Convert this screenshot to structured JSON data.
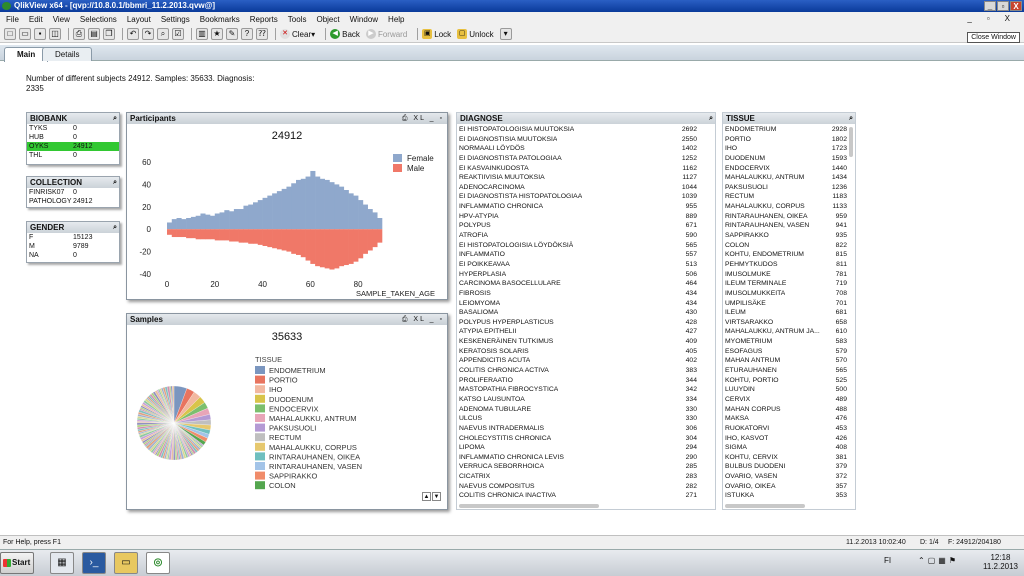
{
  "window": {
    "title": "QlikView x64 - [qvp://10.8.0.1/bbmri_11.2.2013.qvw@]",
    "close_window_label": "Close Window",
    "controls": [
      "_",
      "▫",
      "X"
    ],
    "mdi_controls": [
      "_",
      "▫",
      "X"
    ]
  },
  "menu": [
    "File",
    "Edit",
    "View",
    "Selections",
    "Layout",
    "Settings",
    "Bookmarks",
    "Reports",
    "Tools",
    "Object",
    "Window",
    "Help"
  ],
  "toolbar": {
    "clear": "Clear",
    "back": "Back",
    "forward": "Forward",
    "lock": "Lock",
    "unlock": "Unlock"
  },
  "tabs": [
    {
      "label": "Main",
      "active": true
    },
    {
      "label": "Details",
      "active": false
    }
  ],
  "summary": "Number of different subjects 24912. Samples: 35633. Diagnosis: 2335",
  "biobank": {
    "title": "BIOBANK",
    "rows": [
      {
        "name": "TYKS",
        "value": "0",
        "selected": false
      },
      {
        "name": "HUB",
        "value": "0",
        "selected": false
      },
      {
        "name": "OYKS",
        "value": "24912",
        "selected": true
      },
      {
        "name": "THL",
        "value": "0",
        "selected": false
      }
    ]
  },
  "collection": {
    "title": "COLLECTION",
    "rows": [
      {
        "name": "FINRISK07",
        "value": "0"
      },
      {
        "name": "PATHOLOGY",
        "value": "24912"
      }
    ]
  },
  "gender": {
    "title": "GENDER",
    "rows": [
      {
        "name": "F",
        "value": "15123"
      },
      {
        "name": "M",
        "value": "9789"
      },
      {
        "name": "NA",
        "value": "0"
      }
    ]
  },
  "participants": {
    "title": "Participants",
    "controls": "⎙ XL _ ▫",
    "total": "24912"
  },
  "samples": {
    "title": "Samples",
    "controls": "⎙ XL _ ▫",
    "total": "35633"
  },
  "diagnose": {
    "title": "DIAGNOSE",
    "rows": [
      [
        "EI HISTOPATOLOGISIA MUUTOKSIA",
        "2692"
      ],
      [
        "EI DIAGNOSTISIA MUUTOKSIA",
        "2550"
      ],
      [
        "NORMAALI LÖYDÖS",
        "1402"
      ],
      [
        "EI DIAGNOSTISTA PATOLOGIAA",
        "1252"
      ],
      [
        "EI KASVAINKUDOSTA",
        "1162"
      ],
      [
        "REAKTIIVISIA MUUTOKSIA",
        "1127"
      ],
      [
        "ADENOCARCINOMA",
        "1044"
      ],
      [
        "EI DIAGNOSTISTA HISTOPATOLOGIAA",
        "1039"
      ],
      [
        "INFLAMMATIO CHRONICA",
        "955"
      ],
      [
        "HPV-ATYPIA",
        "889"
      ],
      [
        "POLYPUS",
        "671"
      ],
      [
        "ATROFIA",
        "590"
      ],
      [
        "EI HISTOPATOLOGISIA LÖYDÖKSIÄ",
        "565"
      ],
      [
        "INFLAMMATIO",
        "557"
      ],
      [
        "EI POIKKEAVAA",
        "513"
      ],
      [
        "HYPERPLASIA",
        "506"
      ],
      [
        "CARCINOMA BASOCELLULARE",
        "464"
      ],
      [
        "FIBROSIS",
        "434"
      ],
      [
        "LEIOMYOMA",
        "434"
      ],
      [
        "BASALIOMA",
        "430"
      ],
      [
        "POLYPUS HYPERPLASTICUS",
        "428"
      ],
      [
        "ATYPIA EPITHELII",
        "427"
      ],
      [
        "KESKENERÄINEN TUTKIMUS",
        "409"
      ],
      [
        "KERATOSIS SOLARIS",
        "405"
      ],
      [
        "APPENDICITIS ACUTA",
        "402"
      ],
      [
        "COLITIS CHRONICA ACTIVA",
        "383"
      ],
      [
        "PROLIFERAATIO",
        "344"
      ],
      [
        "MASTOPATHIA FIBROCYSTICA",
        "342"
      ],
      [
        "KATSO LAUSUNTOA",
        "334"
      ],
      [
        "ADENOMA TUBULARE",
        "330"
      ],
      [
        "ULCUS",
        "330"
      ],
      [
        "NAEVUS INTRADERMALIS",
        "306"
      ],
      [
        "CHOLECYSTITIS CHRONICA",
        "304"
      ],
      [
        "LIPOMA",
        "294"
      ],
      [
        "INFLAMMATIO CHRONICA LEVIS",
        "290"
      ],
      [
        "VERRUCA SEBORRHOICA",
        "285"
      ],
      [
        "CICATRIX",
        "283"
      ],
      [
        "NAEVUS COMPOSITUS",
        "282"
      ],
      [
        "COLITIS CHRONICA INACTIVA",
        "271"
      ]
    ]
  },
  "tissue": {
    "title": "TISSUE",
    "rows": [
      [
        "ENDOMETRIUM",
        "2928"
      ],
      [
        "PORTIO",
        "1802"
      ],
      [
        "IHO",
        "1723"
      ],
      [
        "DUODENUM",
        "1593"
      ],
      [
        "ENDOCERVIX",
        "1440"
      ],
      [
        "MAHALAUKKU, ANTRUM",
        "1434"
      ],
      [
        "PAKSUSUOLI",
        "1236"
      ],
      [
        "RECTUM",
        "1183"
      ],
      [
        "MAHALAUKKU, CORPUS",
        "1133"
      ],
      [
        "RINTARAUHANEN, OIKEA",
        "959"
      ],
      [
        "RINTARAUHANEN, VASEN",
        "941"
      ],
      [
        "SAPPIRAKKO",
        "935"
      ],
      [
        "COLON",
        "822"
      ],
      [
        "KOHTU, ENDOMETRIUM",
        "815"
      ],
      [
        "PEHMYTKUDOS",
        "811"
      ],
      [
        "IMUSOLMUKE",
        "781"
      ],
      [
        "ILEUM TERMINALE",
        "719"
      ],
      [
        "IMUSOLMUKKEITA",
        "708"
      ],
      [
        "UMPILISÄKE",
        "701"
      ],
      [
        "ILEUM",
        "681"
      ],
      [
        "VIRTSARAKKO",
        "658"
      ],
      [
        "MAHALAUKKU, ANTRUM JA...",
        "610"
      ],
      [
        "MYOMETRIUM",
        "583"
      ],
      [
        "ESOFAGUS",
        "579"
      ],
      [
        "MAHAN ANTRUM",
        "570"
      ],
      [
        "ETURAUHANEN",
        "565"
      ],
      [
        "KOHTU, PORTIO",
        "525"
      ],
      [
        "LUUYDIN",
        "500"
      ],
      [
        "CERVIX",
        "489"
      ],
      [
        "MAHAN CORPUS",
        "488"
      ],
      [
        "MAKSA",
        "476"
      ],
      [
        "RUOKATORVI",
        "453"
      ],
      [
        "IHO, KASVOT",
        "426"
      ],
      [
        "SIGMA",
        "408"
      ],
      [
        "KOHTU, CERVIX",
        "381"
      ],
      [
        "BULBUS DUODENI",
        "379"
      ],
      [
        "OVARIO, VASEN",
        "372"
      ],
      [
        "OVARIO, OIKEA",
        "357"
      ],
      [
        "ISTUKKA",
        "353"
      ]
    ]
  },
  "status": {
    "help": "For Help, press F1",
    "datetime": "11.2.2013 10:02:40",
    "doc": "D: 1/4",
    "filter": "F: 24912/204180"
  },
  "taskbar": {
    "start": "Start",
    "lang": "FI",
    "time": "12:18",
    "date": "11.2.2013"
  },
  "colors": {
    "female": "#8fa8cc",
    "male": "#f07868",
    "selected": "#32c832",
    "titlebar": "#0a3a9a"
  },
  "chart_data": [
    {
      "type": "bar",
      "title": "24912",
      "xlabel": "SAMPLE_TAKEN_AGE",
      "ylabel": "",
      "xlim": [
        0,
        90
      ],
      "ylim": [
        -40,
        60
      ],
      "xticks": [
        0,
        20,
        40,
        60,
        80
      ],
      "yticks": [
        60,
        40,
        20,
        0,
        -20,
        -40
      ],
      "legend": "top-right",
      "series": [
        {
          "name": "Female",
          "color": "#8fa8cc",
          "x": [
            0,
            2,
            4,
            6,
            8,
            10,
            12,
            14,
            16,
            18,
            20,
            22,
            24,
            26,
            28,
            30,
            32,
            34,
            36,
            38,
            40,
            42,
            44,
            46,
            48,
            50,
            52,
            54,
            56,
            58,
            60,
            62,
            64,
            66,
            68,
            70,
            72,
            74,
            76,
            78,
            80,
            82,
            84,
            86,
            88
          ],
          "values": [
            6,
            9,
            10,
            9,
            10,
            11,
            12,
            14,
            13,
            12,
            14,
            15,
            17,
            16,
            18,
            18,
            21,
            22,
            24,
            26,
            28,
            30,
            32,
            34,
            36,
            38,
            41,
            44,
            45,
            47,
            52,
            47,
            45,
            44,
            42,
            40,
            38,
            35,
            32,
            30,
            26,
            22,
            18,
            15,
            10
          ]
        },
        {
          "name": "Male",
          "color": "#f07868",
          "x": [
            0,
            2,
            4,
            6,
            8,
            10,
            12,
            14,
            16,
            18,
            20,
            22,
            24,
            26,
            28,
            30,
            32,
            34,
            36,
            38,
            40,
            42,
            44,
            46,
            48,
            50,
            52,
            54,
            56,
            58,
            60,
            62,
            64,
            66,
            68,
            70,
            72,
            74,
            76,
            78,
            80,
            82,
            84,
            86,
            88
          ],
          "values": [
            -5,
            -7,
            -7,
            -7,
            -8,
            -8,
            -9,
            -9,
            -9,
            -9,
            -10,
            -10,
            -10,
            -11,
            -11,
            -12,
            -12,
            -13,
            -13,
            -14,
            -15,
            -16,
            -17,
            -18,
            -19,
            -20,
            -22,
            -23,
            -25,
            -28,
            -31,
            -33,
            -34,
            -35,
            -36,
            -35,
            -33,
            -32,
            -31,
            -29,
            -26,
            -22,
            -19,
            -16,
            -12
          ]
        }
      ]
    },
    {
      "type": "pie",
      "title": "35633",
      "legend_title": "TISSUE",
      "legend": "right",
      "categories": [
        "ENDOMETRIUM",
        "PORTIO",
        "IHO",
        "DUODENUM",
        "ENDOCERVIX",
        "MAHALAUKKU, ANTRUM",
        "PAKSUSUOLI",
        "RECTUM",
        "MAHALAUKKU, CORPUS",
        "RINTARAUHANEN, OIKEA",
        "RINTARAUHANEN, VASEN",
        "SAPPIRAKKO",
        "COLON"
      ],
      "values": [
        2928,
        1802,
        1723,
        1593,
        1440,
        1434,
        1236,
        1183,
        1133,
        959,
        941,
        935,
        822
      ],
      "colors": [
        "#7b96bf",
        "#e8745f",
        "#f2b8a0",
        "#d8c44a",
        "#7cbf6e",
        "#e8a5b8",
        "#b49ad4",
        "#bfbfbf",
        "#e6c86e",
        "#6fbfbf",
        "#a3c4e8",
        "#f08c6a",
        "#54a64f"
      ]
    }
  ]
}
